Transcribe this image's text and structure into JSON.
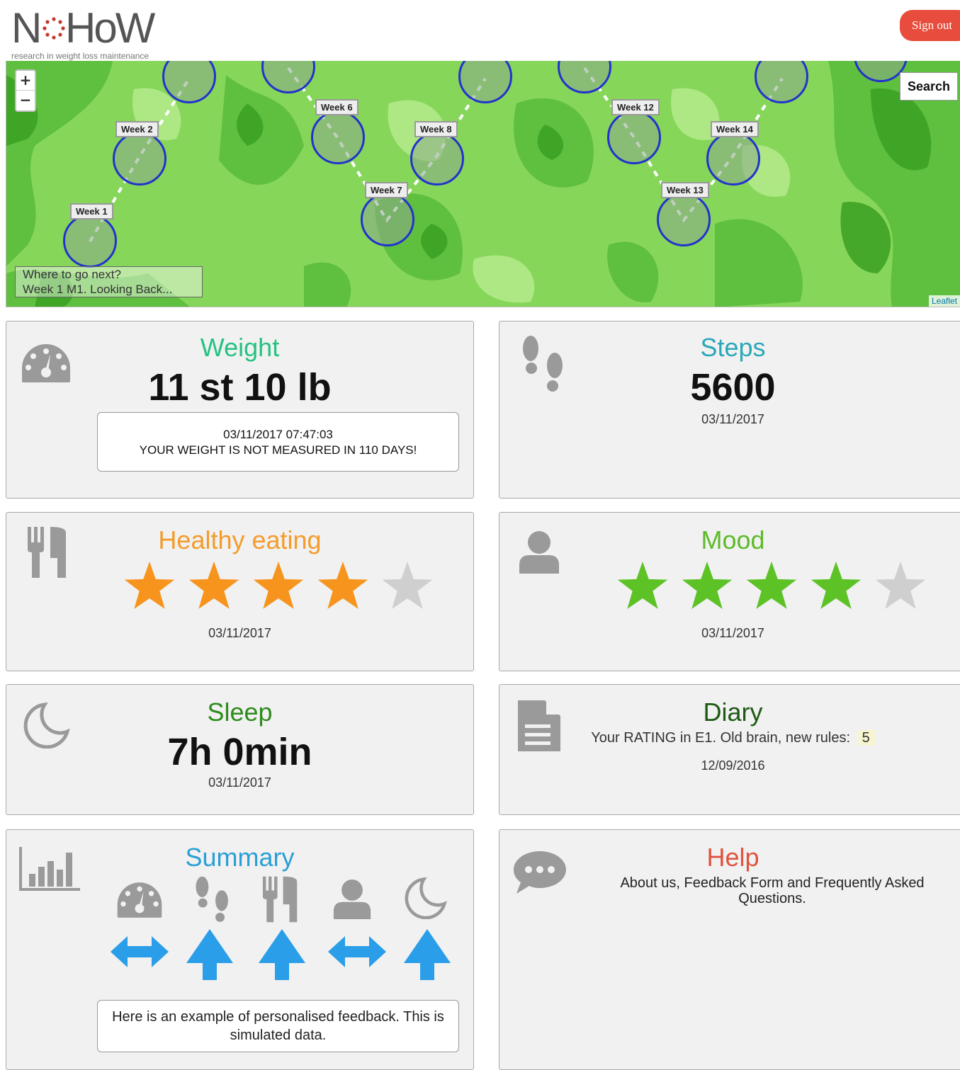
{
  "header": {
    "logo_text": "NoHoW",
    "logo_subtitle": "research in weight loss maintenance",
    "signout_label": "Sign out"
  },
  "map": {
    "zoom_in": "+",
    "zoom_out": "−",
    "search_label": "Search",
    "where_title": "Where to go next?",
    "where_link": "Week 1 M1. Looking Back...",
    "attribution": "Leaflet",
    "weeks": [
      "Week 1",
      "Week 2",
      "Week 6",
      "Week 7",
      "Week 8",
      "Week 12",
      "Week 13",
      "Week 14"
    ]
  },
  "weight": {
    "title": "Weight",
    "value": "11 st 10 lb",
    "timestamp": "03/11/2017  07:47:03",
    "warning": "YOUR WEIGHT IS NOT MEASURED IN 110 DAYS!",
    "title_color": "#26c281"
  },
  "steps": {
    "title": "Steps",
    "value": "5600",
    "date": "03/11/2017",
    "title_color": "#2aa8b8"
  },
  "healthy_eating": {
    "title": "Healthy eating",
    "rating": 4,
    "max": 5,
    "date": "03/11/2017",
    "title_color": "#f39c2c"
  },
  "mood": {
    "title": "Mood",
    "rating": 4,
    "max": 5,
    "date": "03/11/2017",
    "title_color": "#5dbb2a"
  },
  "sleep": {
    "title": "Sleep",
    "value": "7h 0min",
    "date": "03/11/2017",
    "title_color": "#2e8b1e"
  },
  "diary": {
    "title": "Diary",
    "rating_text": "Your RATING in E1. Old brain, new rules:",
    "rating_value": "5",
    "date": "12/09/2016",
    "title_color": "#1e5a14"
  },
  "summary": {
    "title": "Summary",
    "feedback": "Here is an example of personalised feedback. This is simulated data.",
    "title_color": "#2a9fd6",
    "items": [
      {
        "icon": "gauge-icon",
        "trend": "stable"
      },
      {
        "icon": "footprints-icon",
        "trend": "up"
      },
      {
        "icon": "cutlery-icon",
        "trend": "up"
      },
      {
        "icon": "user-icon",
        "trend": "stable"
      },
      {
        "icon": "moon-icon",
        "trend": "up"
      }
    ]
  },
  "help": {
    "title": "Help",
    "text": "About us, Feedback Form and Frequently Asked Questions.",
    "title_color": "#e0533d"
  },
  "colors": {
    "star_orange": "#f7941d",
    "star_green": "#5dc226",
    "star_empty": "#cfcfcf",
    "arrow_blue": "#2a9ee8",
    "icon_grey": "#9a9a9a"
  }
}
